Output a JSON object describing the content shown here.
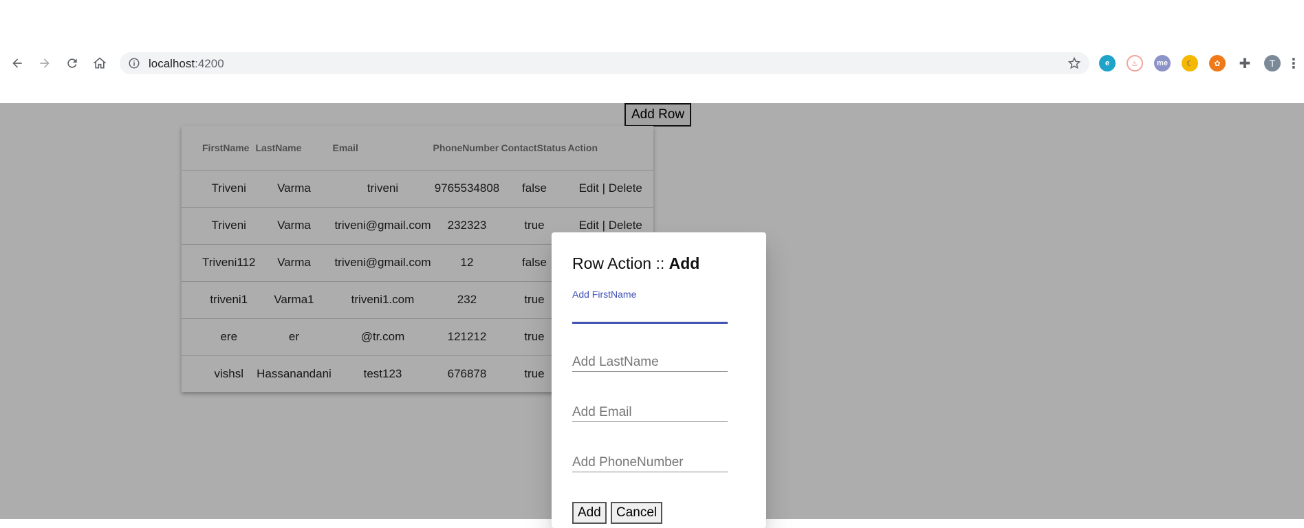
{
  "browser": {
    "url_host": "localhost",
    "url_port": ":4200",
    "profile_initial": "T",
    "extensions": [
      "edge-extension-icon",
      "flame-extension-icon",
      "me-extension-icon",
      "moon-extension-icon",
      "orange-extension-icon",
      "puzzle-extensions-icon"
    ],
    "colors": {
      "accent": "#3f51b5",
      "overlay": "rgba(0,0,0,0.32)"
    }
  },
  "page": {
    "add_row_label": "Add Row",
    "table": {
      "headers": [
        "FirstName",
        "LastName",
        "Email",
        "PhoneNumber",
        "ContactStatus",
        "Action"
      ],
      "rows": [
        [
          "Triveni",
          "Varma",
          "triveni",
          "9765534808",
          "false",
          "Edit | Delete"
        ],
        [
          "Triveni",
          "Varma",
          "triveni@gmail.com",
          "232323",
          "true",
          "Edit | Delete"
        ],
        [
          "Triveni112",
          "Varma",
          "triveni@gmail.com",
          "12",
          "false",
          ""
        ],
        [
          "triveni1",
          "Varma1",
          "triveni1.com",
          "232",
          "true",
          ""
        ],
        [
          "ere",
          "er",
          "@tr.com",
          "121212",
          "true",
          ""
        ],
        [
          "vishsl",
          "Hassanandani",
          "test123",
          "676878",
          "true",
          ""
        ]
      ]
    }
  },
  "dialog": {
    "title_prefix": "Row Action :: ",
    "title_action": "Add",
    "firstname_label": "Add FirstName",
    "lastname_placeholder": "Add LastName",
    "email_placeholder": "Add Email",
    "phone_placeholder": "Add PhoneNumber",
    "add_label": "Add",
    "cancel_label": "Cancel"
  }
}
